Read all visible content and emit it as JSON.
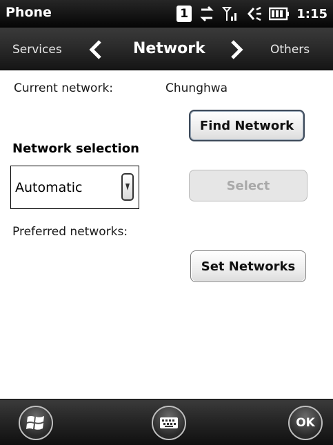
{
  "status_bar": {
    "app_title": "Phone",
    "sim_slot": "1",
    "icons": [
      "sim-icon",
      "data-transfer-icon",
      "signal-icon",
      "volume-icon",
      "battery-icon"
    ],
    "time": "1:15"
  },
  "nav": {
    "prev_label": "Services",
    "current_label": "Network",
    "next_label": "Others"
  },
  "form": {
    "current_network_label": "Current network:",
    "current_network_value": "Chunghwa",
    "find_network_button": "Find Network",
    "network_selection_heading": "Network selection",
    "selection_mode_value": "Automatic",
    "select_button": "Select",
    "preferred_networks_label": "Preferred networks:",
    "set_networks_button": "Set Networks"
  },
  "softkeys": {
    "start_icon": "windows-start-icon",
    "keyboard_icon": "keyboard-icon",
    "ok_label": "OK"
  },
  "colors": {
    "bar_dark": "#1a1a1a",
    "button_border_active": "#3d4a5a",
    "disabled_text": "#a9a9a9"
  }
}
